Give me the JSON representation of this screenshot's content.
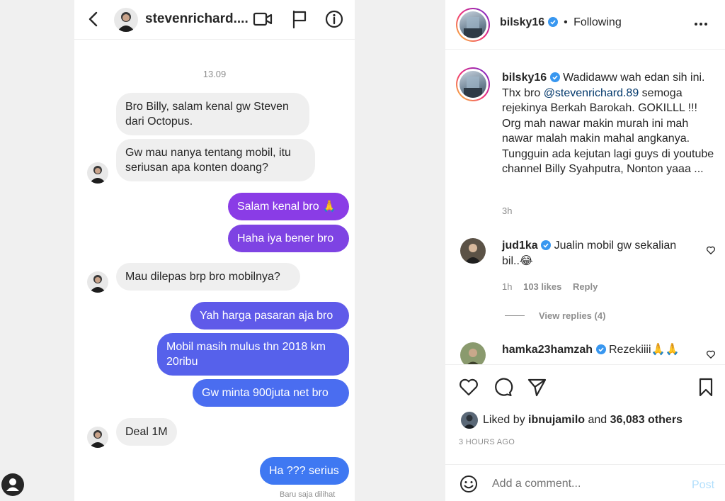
{
  "dm": {
    "username": "stevenrichard....",
    "date": "13.09",
    "messages": [
      {
        "side": "in",
        "text": "Bro Billy, salam kenal gw Steven dari Octopus."
      },
      {
        "side": "in",
        "text": "Gw mau nanya tentang mobil, itu seriusan apa konten doang?"
      },
      {
        "side": "out",
        "text": "Salam kenal bro 🙏",
        "color": "#8a3ce6"
      },
      {
        "side": "out",
        "text": "Haha iya bener bro",
        "color": "#7e43e3"
      },
      {
        "side": "in",
        "text": "Mau dilepas brp bro mobilnya?"
      },
      {
        "side": "out",
        "text": "Yah harga pasaran aja bro",
        "color": "#5f5ae9"
      },
      {
        "side": "out",
        "text": "Mobil masih mulus thn 2018 km 20ribu",
        "color": "#5661eb"
      },
      {
        "side": "out",
        "text": "Gw minta 900juta net bro",
        "color": "#4a6df0"
      },
      {
        "side": "in",
        "text": "Deal 1M"
      },
      {
        "side": "out",
        "text": "Ha ??? serius",
        "color": "#3f78f2"
      }
    ],
    "seen_text": "Baru saja dilihat"
  },
  "post": {
    "author": "bilsky16",
    "follow_state": "Following",
    "separator": "•",
    "caption_username": "bilsky16",
    "caption_parts": {
      "before_mention": "Wadidaww wah edan sih ini. Thx bro ",
      "mention": "@stevenrichard.89",
      "after_mention": " semoga rejekinya Berkah Barokah. GOKILLL !!! Org mah nawar makin murah ini mah nawar malah makin mahal angkanya. Tungguin ada kejutan lagi guys di youtube channel Billy Syahputra, Nonton yaaa ..."
    },
    "caption_time": "3h",
    "comments": [
      {
        "username": "jud1ka",
        "text": "Jualin mobil gw sekalian bil..😂",
        "time": "1h",
        "likes": "103 likes",
        "reply": "Reply",
        "view_replies": "View replies (4)"
      },
      {
        "username": "hamka23hamzah",
        "text": "Rezekiiii🙏🙏"
      }
    ],
    "liked_by_prefix": "Liked by",
    "liked_by_user": "ibnujamilo",
    "liked_by_and": "and",
    "liked_by_others": "36,083 others",
    "timestamp": "3 HOURS AGO",
    "comment_placeholder": "Add a comment...",
    "post_button": "Post"
  },
  "colors": {
    "verified": "#3897f0",
    "post_button_disabled": "#b2dffc",
    "muted": "#8e8e8e"
  }
}
